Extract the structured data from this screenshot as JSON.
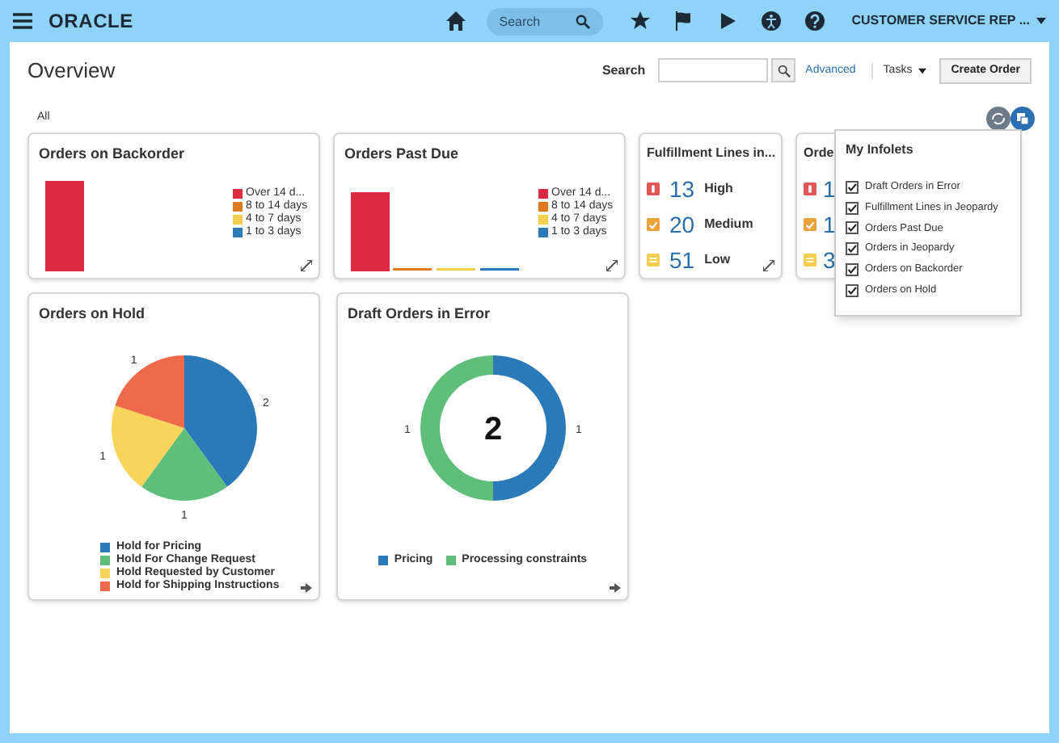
{
  "header": {
    "logo": "ORACLE",
    "search": {
      "placeholder": "Search"
    },
    "user": "CUSTOMER SERVICE REP ..."
  },
  "page": {
    "title": "Overview",
    "search_label": "Search",
    "advanced_link": "Advanced",
    "tasks_menu": "Tasks",
    "create_button": "Create Order",
    "filter": "All"
  },
  "infolets": [
    {
      "kind": "bar",
      "title": "Orders on Backorder",
      "legend": [
        {
          "label": "Over 14 d...",
          "color": "#dc2a40"
        },
        {
          "label": "8 to 14 days",
          "color": "#e07b23"
        },
        {
          "label": "4 to 7 days",
          "color": "#f5cf4f"
        },
        {
          "label": "1 to 3 days",
          "color": "#2a7ab9"
        }
      ]
    },
    {
      "kind": "bar",
      "title": "Orders Past Due",
      "legend": [
        {
          "label": "Over 14 d...",
          "color": "#dc2a40"
        },
        {
          "label": "8 to 14 days",
          "color": "#e07b23"
        },
        {
          "label": "4 to 7 days",
          "color": "#f5cf4f"
        },
        {
          "label": "1 to 3 days",
          "color": "#2a7ab9"
        }
      ]
    },
    {
      "kind": "list",
      "title": "Fulfillment Lines in...",
      "rows": [
        {
          "count": "13",
          "label": "High",
          "color": "#e05757"
        },
        {
          "count": "20",
          "label": "Medium",
          "color": "#eba23a"
        },
        {
          "count": "51",
          "label": "Low",
          "color": "#f5cf4f"
        }
      ]
    },
    {
      "kind": "list",
      "title": "Orde",
      "rows": [
        {
          "count": "1",
          "color": "#e05757"
        },
        {
          "count": "1",
          "color": "#eba23a"
        },
        {
          "count": "3",
          "color": "#f5cf4f"
        }
      ]
    }
  ],
  "charts": [
    {
      "title": "Orders on Hold",
      "chart_data": {
        "type": "pie",
        "categories": [
          "Hold for Pricing",
          "Hold For Change Request",
          "Hold Requested by Customer",
          "Hold for Shipping Instructions"
        ],
        "series": [
          {
            "values": [
              2,
              1,
              1,
              1
            ]
          }
        ],
        "colors": [
          "#2a7ab9",
          "#5fbf7a",
          "#f8d45a",
          "#ee6a4a"
        ],
        "data_labels": true
      }
    },
    {
      "title": "Draft Orders in Error",
      "center_label": "2",
      "chart_data": {
        "type": "donut",
        "categories": [
          "Pricing",
          "Processing constraints"
        ],
        "series": [
          {
            "values": [
              1,
              1
            ]
          }
        ],
        "colors": [
          "#2a7ab9",
          "#5fbf7a"
        ],
        "data_labels": true
      }
    }
  ],
  "popover": {
    "title": "My Infolets",
    "items": [
      {
        "label": "Draft Orders in Error",
        "checked": true
      },
      {
        "label": "Fulfillment Lines in Jeopardy",
        "checked": true
      },
      {
        "label": "Orders Past Due",
        "checked": true
      },
      {
        "label": "Orders in Jeopardy",
        "checked": true
      },
      {
        "label": "Orders on Backorder",
        "checked": true
      },
      {
        "label": "Orders on Hold",
        "checked": true
      }
    ]
  }
}
